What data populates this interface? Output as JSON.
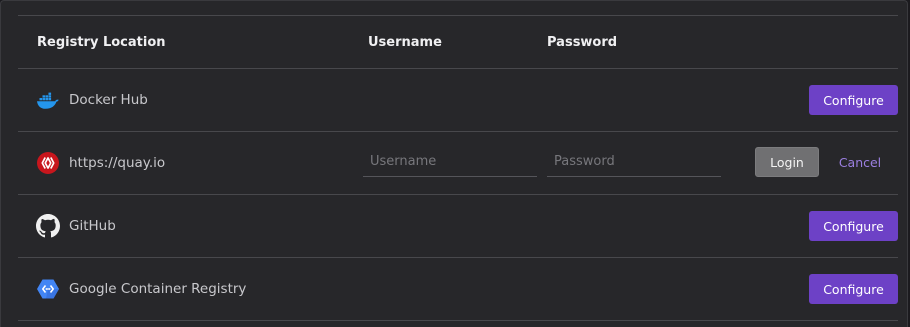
{
  "table": {
    "headers": {
      "location": "Registry Location",
      "username": "Username",
      "password": "Password"
    },
    "rows": [
      {
        "name": "Docker Hub",
        "icon": "docker-icon",
        "action": "Configure"
      },
      {
        "name": "https://quay.io",
        "icon": "quay-icon",
        "username_placeholder": "Username",
        "password_placeholder": "Password",
        "login": "Login",
        "cancel": "Cancel"
      },
      {
        "name": "GitHub",
        "icon": "github-icon",
        "action": "Configure"
      },
      {
        "name": "Google Container Registry",
        "icon": "google-cloud-icon",
        "action": "Configure"
      }
    ]
  },
  "colors": {
    "accent": "#6d41c6",
    "cancel_link": "#9b7fe0",
    "login_button": "#707072",
    "panel_bg": "#27272a"
  }
}
